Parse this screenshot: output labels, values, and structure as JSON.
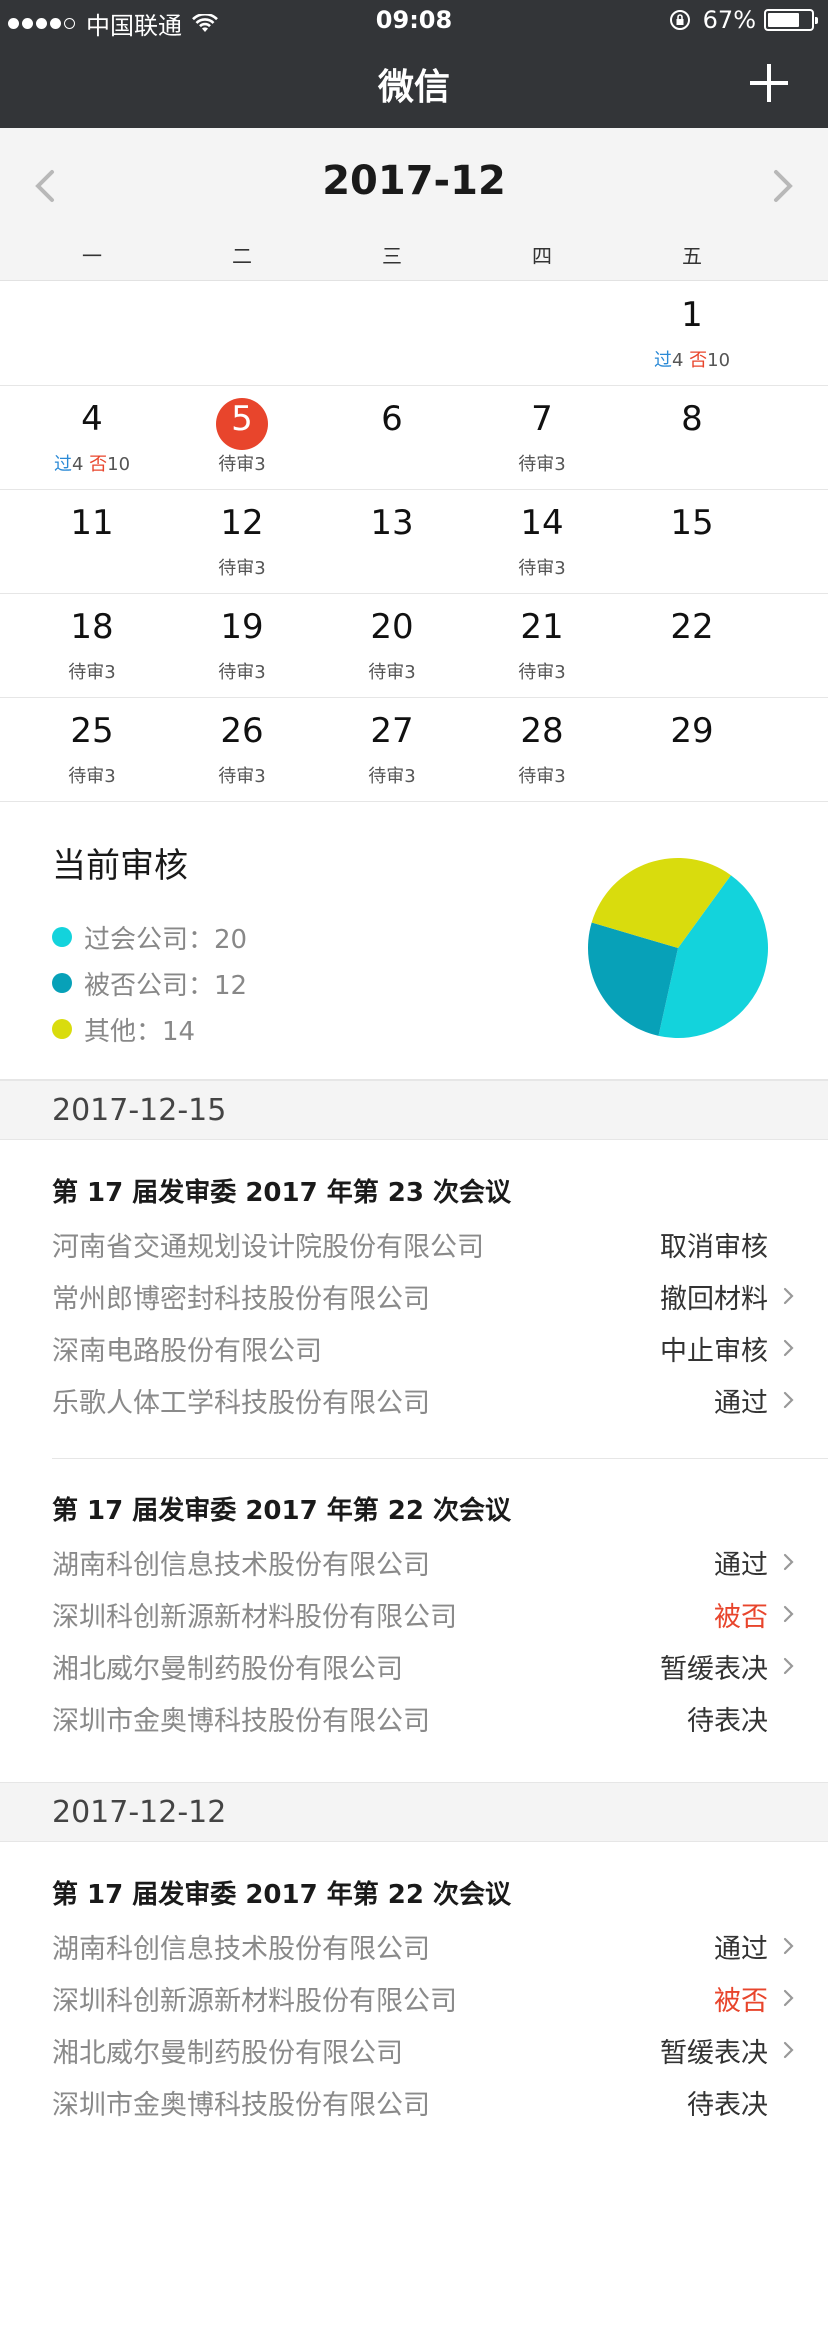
{
  "status_bar": {
    "carrier": "中国联通",
    "time": "09:08",
    "battery": "67%",
    "battery_level": 0.67
  },
  "nav": {
    "title": "微信"
  },
  "calendar": {
    "month": "2017-12",
    "weekdays": [
      "一",
      "二",
      "三",
      "四",
      "五"
    ],
    "rows": [
      [
        {
          "day": ""
        },
        {
          "day": ""
        },
        {
          "day": ""
        },
        {
          "day": ""
        },
        {
          "day": "1",
          "pass_label": "过",
          "pass": "4",
          "rej_label": "否",
          "rej": "10"
        }
      ],
      [
        {
          "day": "4",
          "pass_label": "过",
          "pass": "4",
          "rej_label": "否",
          "rej": "10"
        },
        {
          "day": "5",
          "note": "待审3",
          "selected": true
        },
        {
          "day": "6"
        },
        {
          "day": "7",
          "note": "待审3"
        },
        {
          "day": "8"
        }
      ],
      [
        {
          "day": "11"
        },
        {
          "day": "12",
          "note": "待审3"
        },
        {
          "day": "13"
        },
        {
          "day": "14",
          "note": "待审3"
        },
        {
          "day": "15"
        }
      ],
      [
        {
          "day": "18",
          "note": "待审3"
        },
        {
          "day": "19",
          "note": "待审3"
        },
        {
          "day": "20",
          "note": "待审3"
        },
        {
          "day": "21",
          "note": "待审3"
        },
        {
          "day": "22"
        }
      ],
      [
        {
          "day": "25",
          "note": "待审3"
        },
        {
          "day": "26",
          "note": "待审3"
        },
        {
          "day": "27",
          "note": "待审3"
        },
        {
          "day": "28",
          "note": "待审3"
        },
        {
          "day": "29"
        }
      ]
    ]
  },
  "review": {
    "title": "当前审核",
    "items": [
      {
        "label": "过会公司：20",
        "color": "#13d3dc"
      },
      {
        "label": "被否公司：12",
        "color": "#07a1b8"
      },
      {
        "label": "其他：14",
        "color": "#d9dc0d"
      }
    ]
  },
  "chart_data": {
    "type": "pie",
    "categories": [
      "过会公司",
      "被否公司",
      "其他"
    ],
    "values": [
      20,
      12,
      14
    ],
    "colors": [
      "#13d3dc",
      "#07a1b8",
      "#d9dc0d"
    ]
  },
  "sections": [
    {
      "date": "2017-12-15",
      "meetings": [
        {
          "title": "第 17 届发审委 2017 年第 23 次会议",
          "rows": [
            {
              "company": "河南省交通规划设计院股份有限公司",
              "status": "取消审核",
              "arrow": false
            },
            {
              "company": "常州郎博密封科技股份有限公司",
              "status": "撤回材料",
              "arrow": true
            },
            {
              "company": "深南电路股份有限公司",
              "status": "中止审核",
              "arrow": true
            },
            {
              "company": "乐歌人体工学科技股份有限公司",
              "status": "通过",
              "arrow": true
            }
          ]
        },
        {
          "title": "第 17 届发审委 2017 年第 22 次会议",
          "rows": [
            {
              "company": "湖南科创信息技术股份有限公司",
              "status": "通过",
              "arrow": true
            },
            {
              "company": "深圳科创新源新材料股份有限公司",
              "status": "被否",
              "arrow": true,
              "red": true
            },
            {
              "company": "湘北威尔曼制药股份有限公司",
              "status": "暂缓表决",
              "arrow": true
            },
            {
              "company": "深圳市金奥博科技股份有限公司",
              "status": "待表决",
              "arrow": false
            }
          ]
        }
      ]
    },
    {
      "date": "2017-12-12",
      "meetings": [
        {
          "title": "第 17 届发审委 2017 年第 22 次会议",
          "rows": [
            {
              "company": "湖南科创信息技术股份有限公司",
              "status": "通过",
              "arrow": true
            },
            {
              "company": "深圳科创新源新材料股份有限公司",
              "status": "被否",
              "arrow": true,
              "red": true
            },
            {
              "company": "湘北威尔曼制药股份有限公司",
              "status": "暂缓表决",
              "arrow": true
            },
            {
              "company": "深圳市金奥博科技股份有限公司",
              "status": "待表决",
              "arrow": false
            }
          ]
        }
      ]
    }
  ]
}
